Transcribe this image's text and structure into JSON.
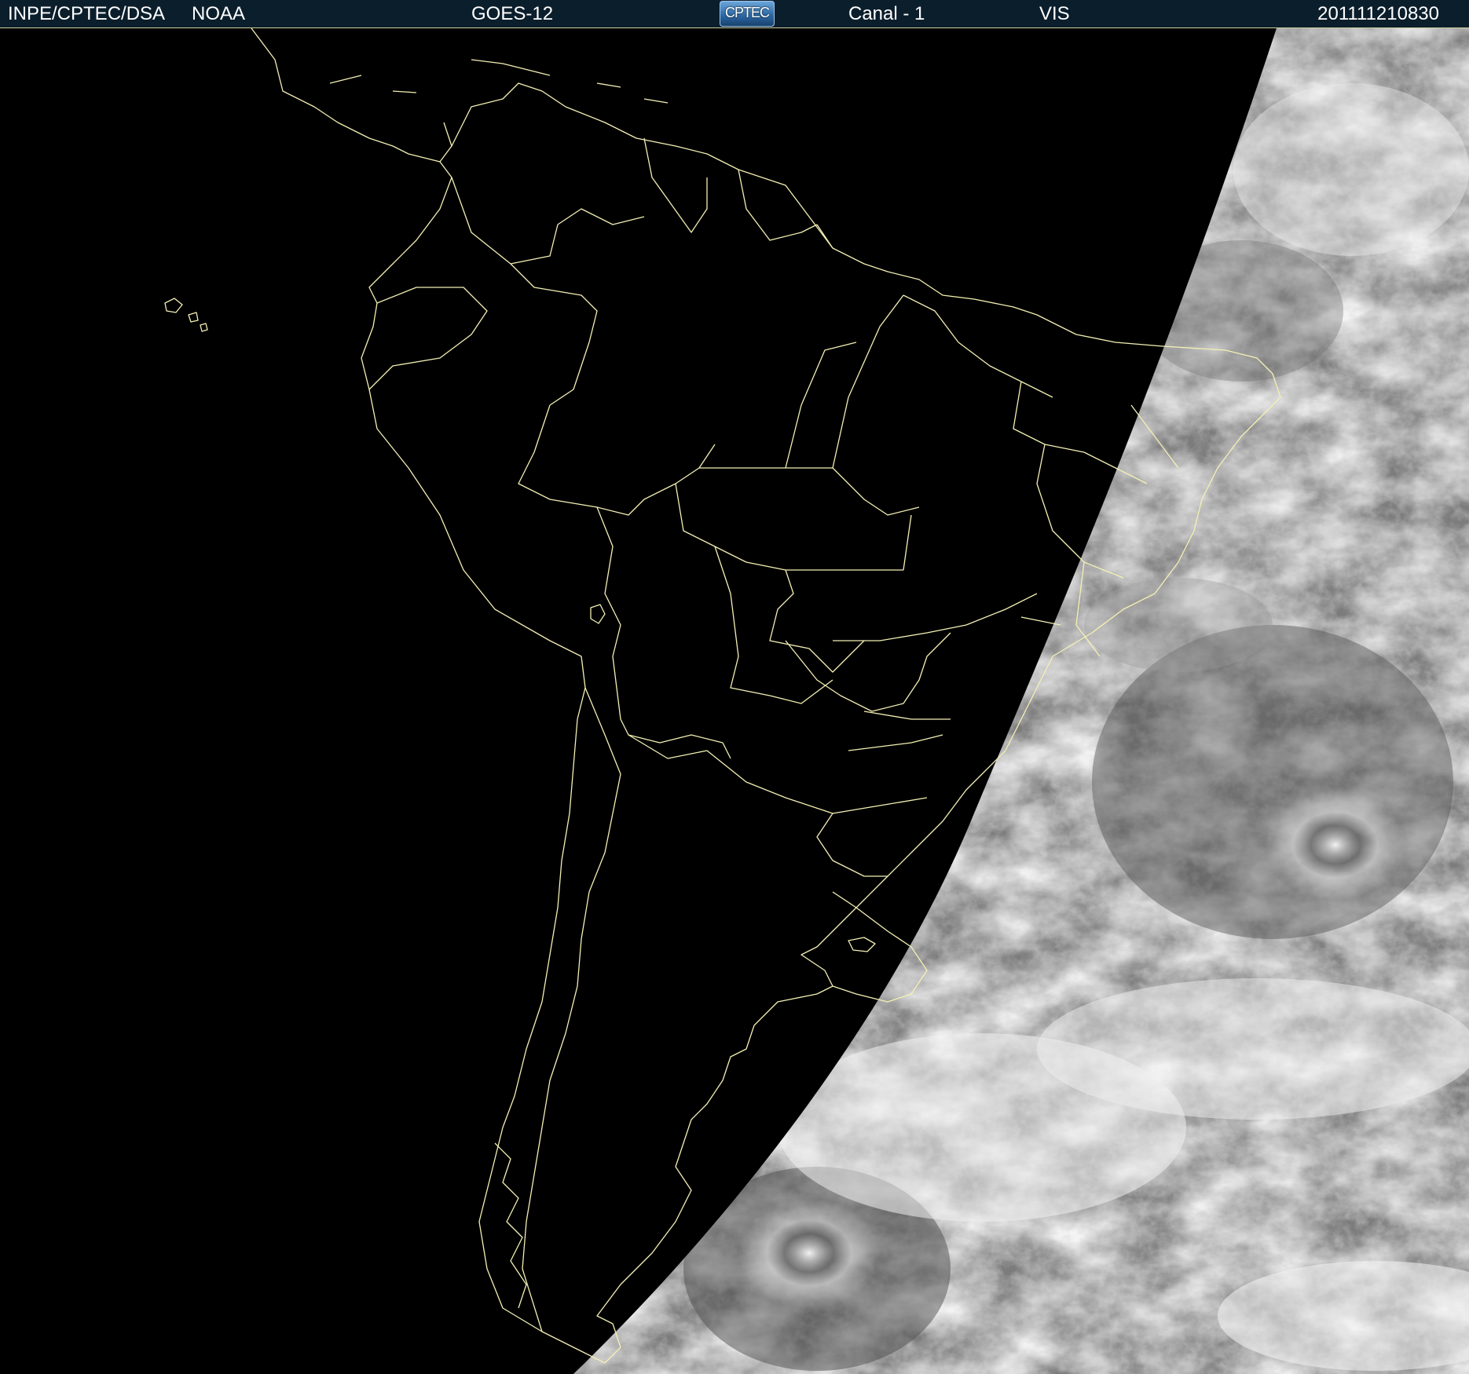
{
  "header": {
    "organization": "INPE/CPTEC/DSA",
    "agency": "NOAA",
    "satellite": "GOES-12",
    "logo_text": "CPTEC",
    "channel": "Canal - 1",
    "band": "VIS",
    "timestamp": "201111210830"
  },
  "colors": {
    "header_background": "#0b1e2c",
    "header_text": "#ffffff",
    "border_lines": "#f4f0b4",
    "night_side": "#000000",
    "cloud_bright": "#f2f2f2",
    "cloud_gray": "#8a8a8a"
  },
  "map": {
    "region": "South America",
    "imagery": "visible channel satellite image, night side dark, day side with clouds"
  }
}
